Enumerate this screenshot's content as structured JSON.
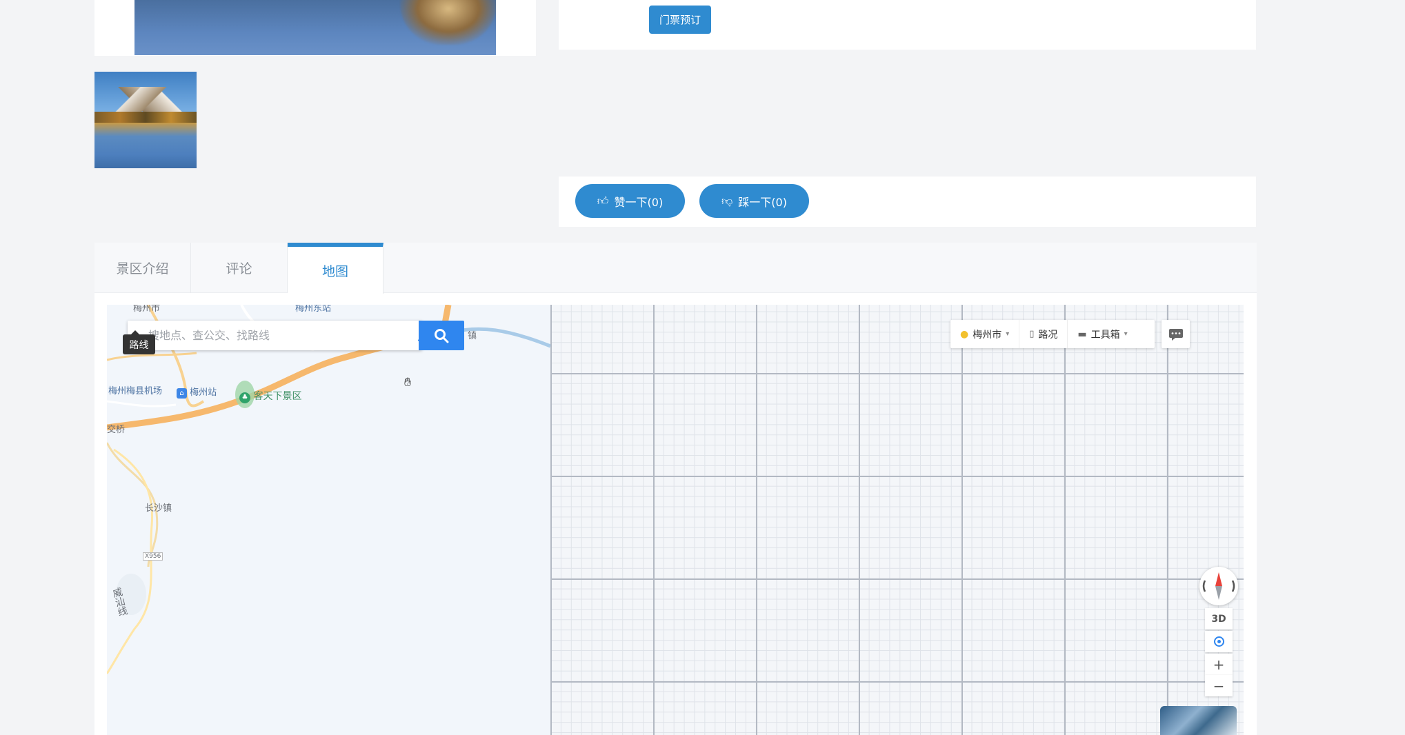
{
  "booking": {
    "button_label": "门票预订"
  },
  "votes": {
    "like_label": "赞一下(0)",
    "dislike_label": "踩一下(0)"
  },
  "tabs": [
    {
      "label": "景区介绍",
      "active": false
    },
    {
      "label": "评论",
      "active": false
    },
    {
      "label": "地图",
      "active": true
    }
  ],
  "map": {
    "search": {
      "placeholder": "搜地点、查公交、找路线",
      "value": ""
    },
    "route_tooltip": "路线",
    "toolbar": {
      "city_label": "梅州市",
      "traffic_label": "路况",
      "tools_label": "工具箱"
    },
    "controls": {
      "three_d_label": "3D",
      "zoom_in": "+",
      "zoom_out": "−"
    },
    "places": {
      "city": "梅州市",
      "east_station": "梅州东站",
      "airport": "梅州梅县机场",
      "station": "梅州站",
      "scenic": "客天下景区",
      "bridge": "交桥",
      "town_changsha": "长沙镇",
      "road_code": "X956",
      "line": "威汕线",
      "town_partial": "镇"
    },
    "colors": {
      "road_major": "#f6b86d",
      "road_minor": "#ffffff",
      "water": "#a9cbe8",
      "accent": "#2f86ef"
    }
  },
  "colors": {
    "primary": "#2f8bd0",
    "page_bg": "#f3f4f6"
  }
}
